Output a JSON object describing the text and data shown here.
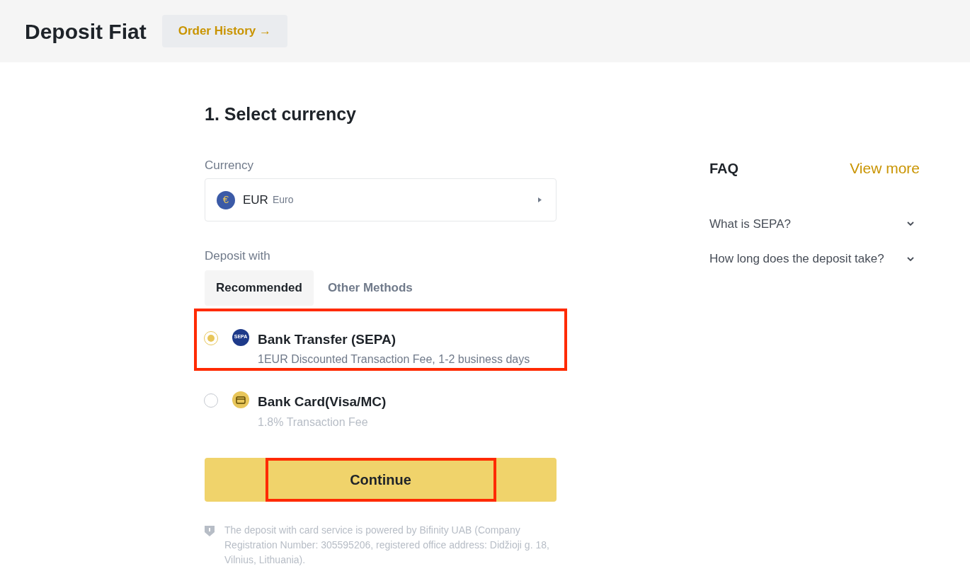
{
  "header": {
    "title": "Deposit Fiat",
    "order_history": "Order History →"
  },
  "step_title": "1. Select currency",
  "currency": {
    "label": "Currency",
    "code": "EUR",
    "name": "Euro",
    "symbol": "€"
  },
  "deposit": {
    "label": "Deposit with",
    "tabs": [
      {
        "label": "Recommended",
        "selected": true
      },
      {
        "label": "Other Methods",
        "selected": false
      }
    ],
    "methods": [
      {
        "kind": "sepa",
        "badge": "SEPA",
        "title": "Bank Transfer (SEPA)",
        "detail": "1EUR Discounted Transaction Fee, 1-2 business days",
        "selected": true,
        "highlighted": true
      },
      {
        "kind": "card",
        "title": "Bank Card(Visa/MC)",
        "detail": "1.8% Transaction Fee",
        "selected": false,
        "highlighted": false
      }
    ]
  },
  "continue": {
    "label": "Continue",
    "highlighted": true
  },
  "note": "The deposit with card service is powered by Bifinity UAB (Company Registration Number: 305595206, registered office address: Didžioji g. 18, Vilnius, Lithuania).",
  "faq": {
    "title": "FAQ",
    "view_more": "View more",
    "items": [
      {
        "question": "What is SEPA?",
        "expanded": false
      },
      {
        "question": "How long does the deposit take?",
        "expanded": false
      }
    ]
  }
}
